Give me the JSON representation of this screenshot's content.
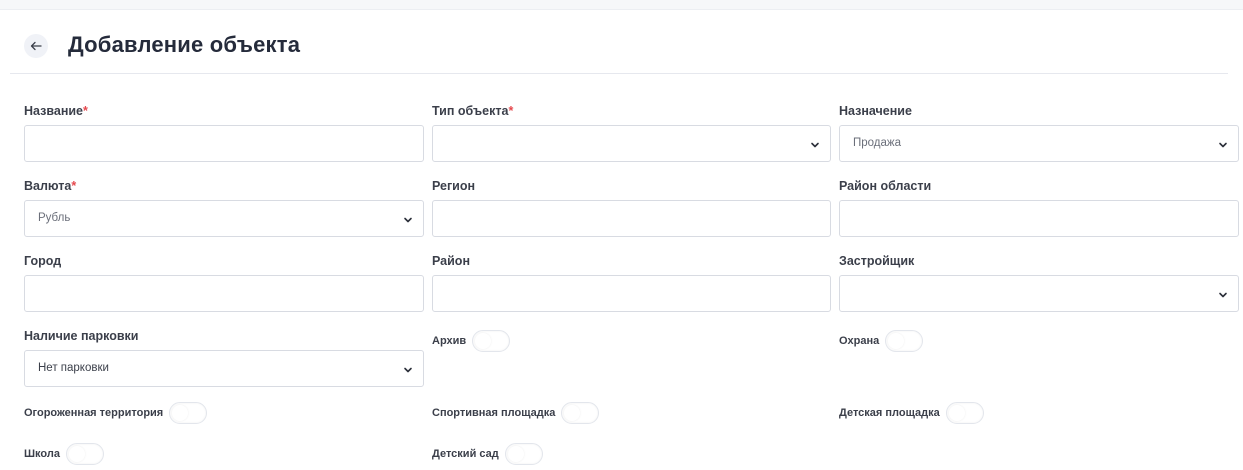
{
  "header": {
    "title": "Добавление объекта"
  },
  "fields": {
    "name": {
      "label": "Название",
      "required": "*",
      "value": ""
    },
    "object_type": {
      "label": "Тип объекта",
      "required": "*",
      "value": ""
    },
    "purpose": {
      "label": "Назначение",
      "value": "Продажа"
    },
    "currency": {
      "label": "Валюта",
      "required": "*",
      "value": "Рубль"
    },
    "region": {
      "label": "Регион",
      "value": ""
    },
    "area_district": {
      "label": "Район области",
      "value": ""
    },
    "city": {
      "label": "Город",
      "value": ""
    },
    "district": {
      "label": "Район",
      "value": ""
    },
    "developer": {
      "label": "Застройщик",
      "value": ""
    },
    "parking": {
      "label": "Наличие парковки",
      "value": "Нет парковки"
    }
  },
  "toggles": {
    "archive": {
      "label": "Архив",
      "on": false
    },
    "security": {
      "label": "Охрана",
      "on": false
    },
    "fenced": {
      "label": "Огороженная территория",
      "on": false
    },
    "sports": {
      "label": "Спортивная площадка",
      "on": false
    },
    "playground": {
      "label": "Детская площадка",
      "on": false
    },
    "school": {
      "label": "Школа",
      "on": false
    },
    "kindergarten": {
      "label": "Детский сад",
      "on": false
    }
  },
  "icons": {
    "back": "arrow-left-icon",
    "dropdown": "chevron-down-icon"
  }
}
